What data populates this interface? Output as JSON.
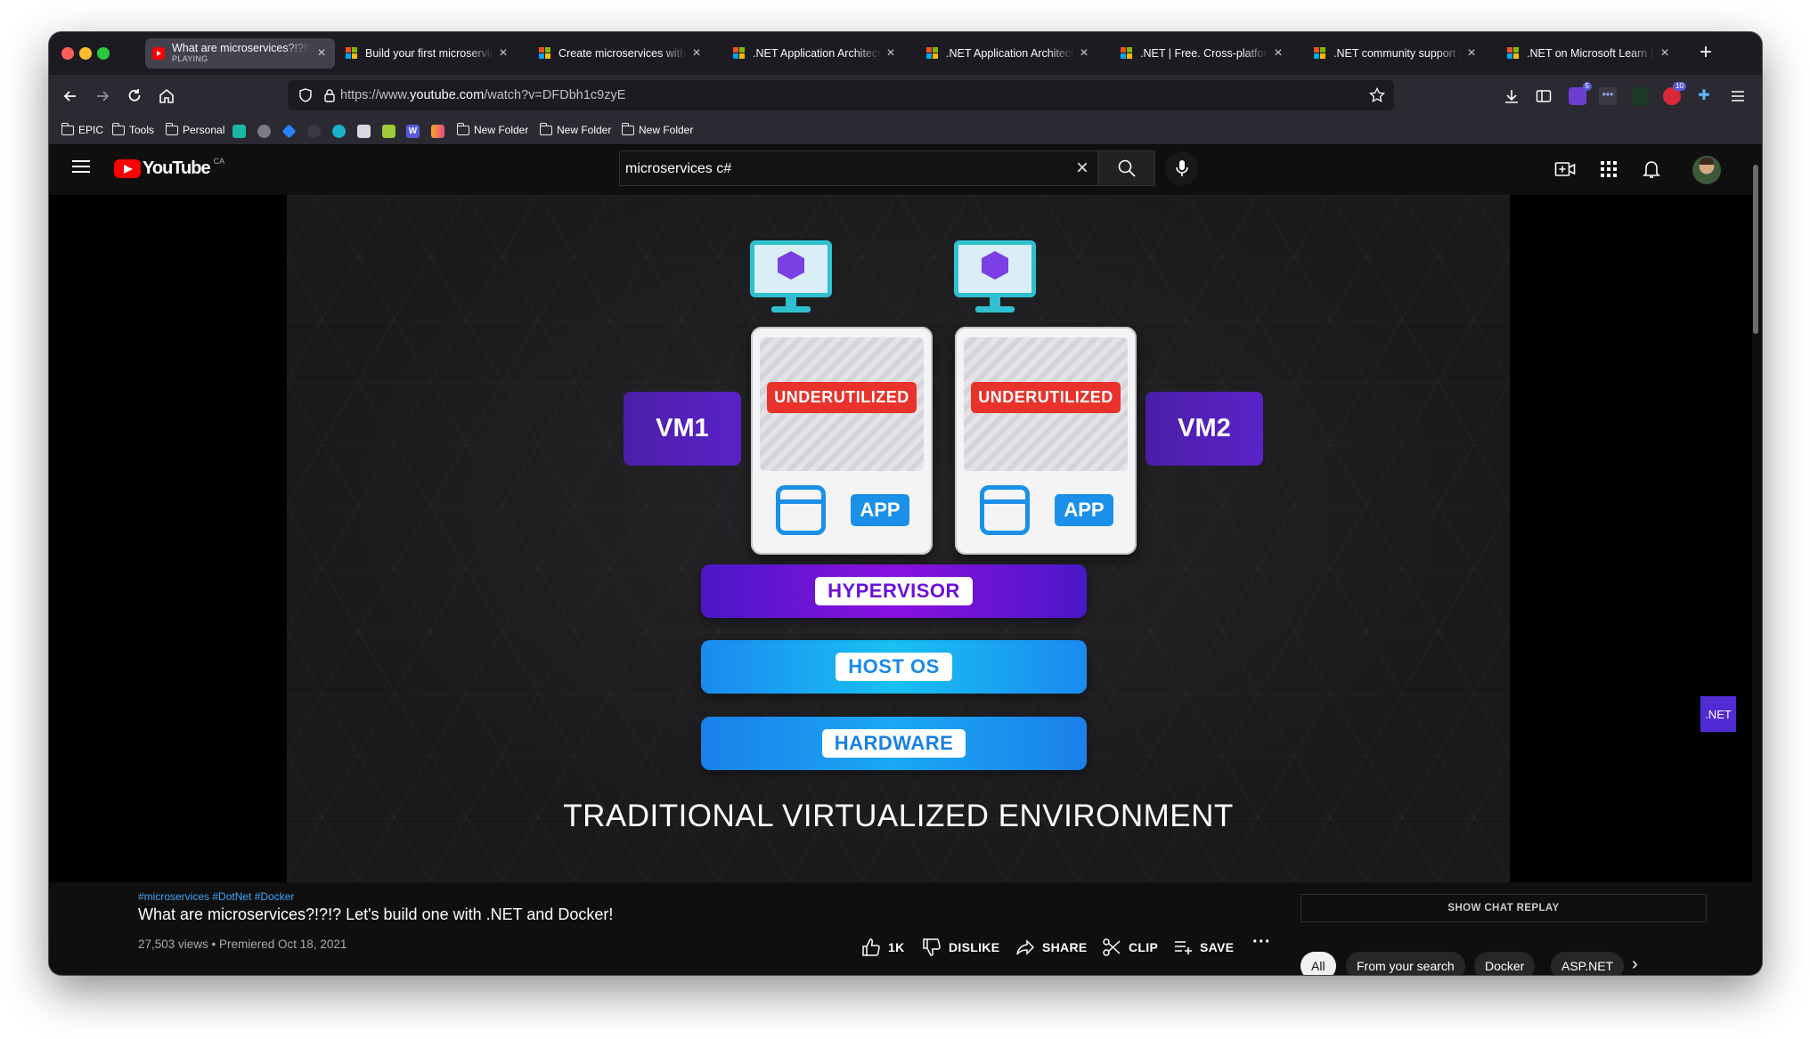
{
  "browser": {
    "tabs": [
      {
        "title": "What are microservices?!?!? Let's build one with .NET and Docker!",
        "subtitle": "PLAYING",
        "favicon": "youtube-icon",
        "active": true
      },
      {
        "title": "Build your first microservice with .NET",
        "favicon": "microsoft-icon"
      },
      {
        "title": "Create microservices with .NET and ASP.NET Core",
        "favicon": "microsoft-icon"
      },
      {
        "title": ".NET Application Architecture Guides",
        "favicon": "microsoft-icon"
      },
      {
        "title": ".NET Application Architecture Guides",
        "favicon": "microsoft-icon"
      },
      {
        "title": ".NET | Free. Cross-platform. Open Source.",
        "favicon": "microsoft-icon"
      },
      {
        "title": ".NET community support | Microsoft",
        "favicon": "microsoft-icon"
      },
      {
        "title": ".NET on Microsoft Learn | Microsoft",
        "favicon": "microsoft-icon"
      }
    ],
    "url_prefix": "https://www.",
    "url_domain": "youtube.com",
    "url_path": "/watch?v=DFDbh1c9zyE",
    "bookmarks": [
      {
        "label": "EPIC",
        "icon": "folder-icon"
      },
      {
        "label": "Tools",
        "icon": "folder-icon"
      },
      {
        "label": "Personal",
        "icon": "folder-icon"
      },
      {
        "label": "New Folder",
        "icon": "folder-icon"
      },
      {
        "label": "New Folder",
        "icon": "folder-icon"
      },
      {
        "label": "New Folder",
        "icon": "folder-icon"
      }
    ],
    "extension_badges": {
      "ext1": "5",
      "ext2": "10"
    }
  },
  "youtube": {
    "logo_text": "YouTube",
    "country": "CA",
    "search_query": "microservices c#"
  },
  "video_frame": {
    "vm1": "VM1",
    "vm2": "VM2",
    "underutilized": "UNDERUTILIZED",
    "app": "APP",
    "hypervisor": "HYPERVISOR",
    "host_os": "HOST OS",
    "hardware": "HARDWARE",
    "caption": "TRADITIONAL VIRTUALIZED ENVIRONMENT",
    "channel_badge": ".NET",
    "colors": {
      "vm": "#4b1fa8",
      "under": "#e8322b",
      "app": "#1a90e8",
      "hypervisor": "#6a12d8",
      "hostos": "#18a8f0",
      "hardware": "#1a90e8"
    }
  },
  "video": {
    "hashtags": "#microservices #DotNet #Docker",
    "title": "What are microservices?!?!? Let's build one with .NET and Docker!",
    "meta": "27,503 views • Premiered Oct 18, 2021",
    "actions": {
      "like": "1K",
      "dislike": "DISLIKE",
      "share": "SHARE",
      "clip": "CLIP",
      "save": "SAVE"
    }
  },
  "sidebar": {
    "chat_replay": "SHOW CHAT REPLAY",
    "chips": [
      "All",
      "From your search",
      "Docker",
      "ASP.NET"
    ]
  }
}
